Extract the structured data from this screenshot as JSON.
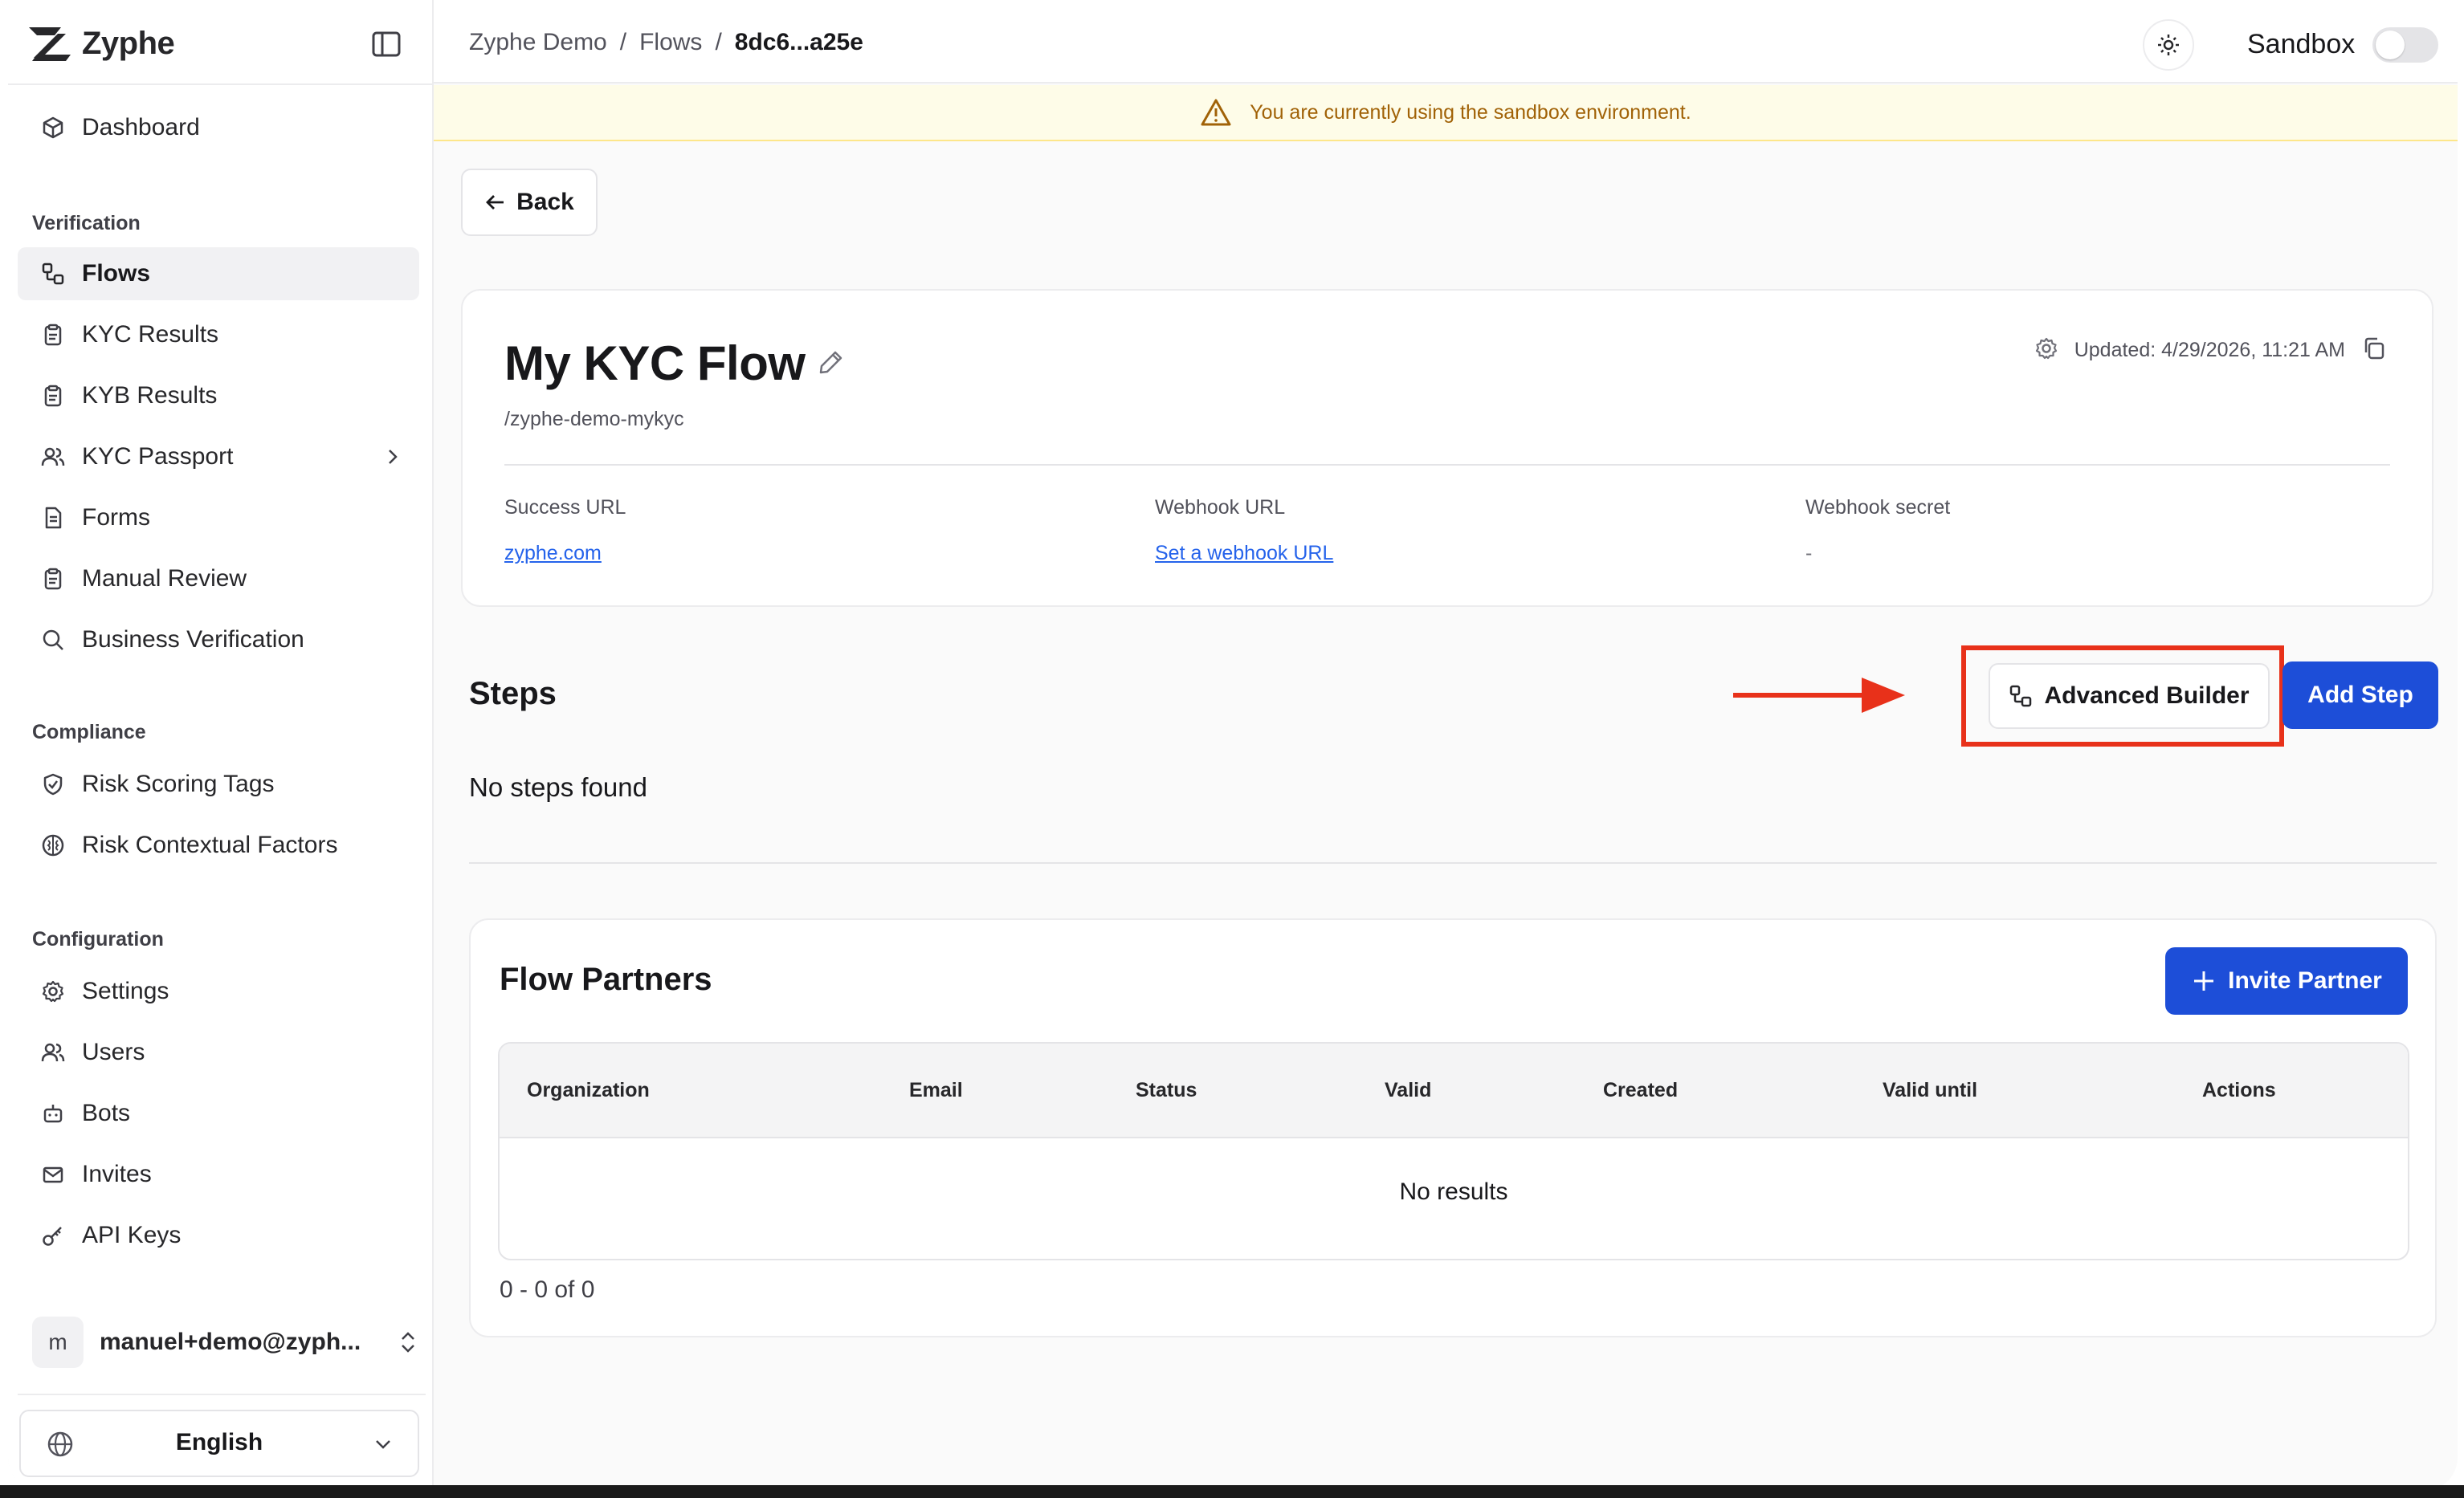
{
  "app": {
    "name": "Zyphe"
  },
  "sidebar": {
    "top_items": [
      {
        "label": "Dashboard",
        "icon": "box-icon"
      }
    ],
    "sections": [
      {
        "title": "Verification",
        "items": [
          {
            "label": "Flows",
            "icon": "flows-icon",
            "active": true
          },
          {
            "label": "KYC Results",
            "icon": "clipboard-icon"
          },
          {
            "label": "KYB Results",
            "icon": "clipboard-icon"
          },
          {
            "label": "KYC Passport",
            "icon": "users-icon",
            "has_submenu": true
          },
          {
            "label": "Forms",
            "icon": "document-icon"
          },
          {
            "label": "Manual Review",
            "icon": "clipboard-icon"
          },
          {
            "label": "Business Verification",
            "icon": "search-icon"
          }
        ]
      },
      {
        "title": "Compliance",
        "items": [
          {
            "label": "Risk Scoring Tags",
            "icon": "shield-icon"
          },
          {
            "label": "Risk Contextual Factors",
            "icon": "brain-icon"
          }
        ]
      },
      {
        "title": "Configuration",
        "items": [
          {
            "label": "Settings",
            "icon": "gear-icon"
          },
          {
            "label": "Users",
            "icon": "users-icon"
          },
          {
            "label": "Bots",
            "icon": "bot-icon"
          },
          {
            "label": "Invites",
            "icon": "mail-icon"
          },
          {
            "label": "API Keys",
            "icon": "key-icon"
          }
        ]
      }
    ],
    "user": {
      "avatar_letter": "m",
      "name": "manuel+demo@zyph..."
    },
    "language": "English"
  },
  "header": {
    "breadcrumbs": [
      "Zyphe Demo",
      "/",
      "Flows",
      "/",
      "8dc6...a25e"
    ],
    "sandbox_label": "Sandbox",
    "sandbox_on": false
  },
  "banner": {
    "text": "You are currently using the sandbox environment.",
    "color": "#a16207"
  },
  "page": {
    "back_label": "Back",
    "flow": {
      "title": "My KYC Flow",
      "slug": "/zyphe-demo-mykyc",
      "updated": "Updated: 4/29/2026, 11:21 AM",
      "success_url_label": "Success URL",
      "success_url": "zyphe.com",
      "webhook_url_label": "Webhook URL",
      "webhook_url": "Set a webhook URL",
      "webhook_secret_label": "Webhook secret",
      "webhook_secret": "-"
    },
    "steps": {
      "title": "Steps",
      "empty": "No steps found",
      "advanced_builder_label": "Advanced Builder",
      "add_step_label": "Add Step"
    },
    "partners": {
      "title": "Flow Partners",
      "invite_label": "Invite Partner",
      "columns": [
        "Organization",
        "Email",
        "Status",
        "Valid",
        "Created",
        "Valid until",
        "Actions"
      ],
      "empty": "No results",
      "pagination": "0 - 0 of 0"
    }
  },
  "colors": {
    "primary": "#1d4ed8",
    "annotation": "#e8311a",
    "link": "#2563eb"
  }
}
